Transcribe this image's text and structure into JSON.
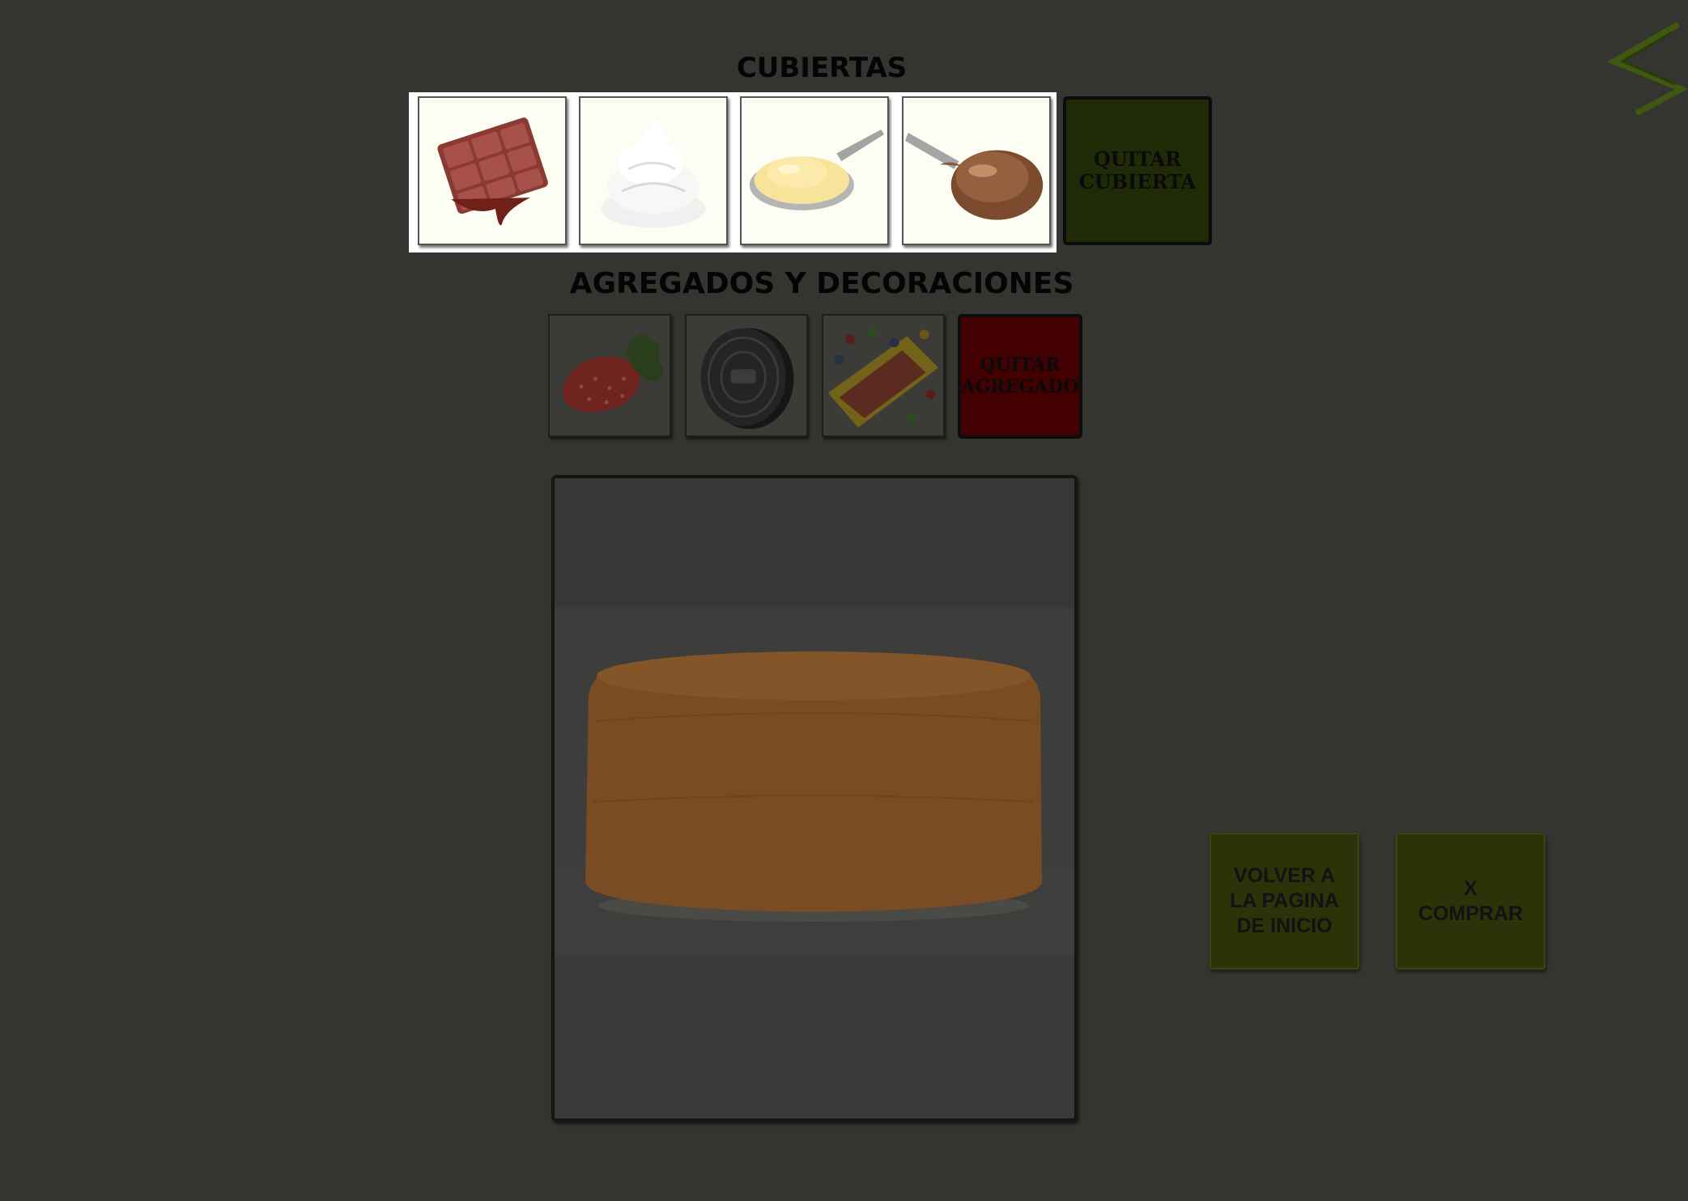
{
  "cubiertas": {
    "title": "CUBIERTAS",
    "options": [
      {
        "name": "chocolate",
        "icon": "chocolate-bar-icon"
      },
      {
        "name": "whipped-cream",
        "icon": "whipped-cream-icon"
      },
      {
        "name": "custard",
        "icon": "custard-spoon-icon"
      },
      {
        "name": "dulce-de-leche",
        "icon": "dulce-de-leche-spoon-icon"
      }
    ],
    "remove_label": "QUITAR CUBIERTA",
    "remove_color": "#212a06"
  },
  "agregados": {
    "title": "AGREGADOS Y DECORACIONES",
    "options": [
      {
        "name": "strawberry",
        "icon": "strawberry-icon"
      },
      {
        "name": "cookie",
        "icon": "sandwich-cookie-icon"
      },
      {
        "name": "candies",
        "icon": "candy-bag-icon"
      }
    ],
    "remove_label": "QUITAR AGREGADO",
    "remove_color": "#430000"
  },
  "preview": {
    "icon": "sponge-cake-image"
  },
  "actions": {
    "back_label": "VOLVER A\nLA PAGINA\nDE INICIO",
    "buy_label": "X\nCOMPRAR",
    "button_color": "#2b3309"
  },
  "brand": {
    "logo_icon": "brand-logo-icon",
    "accent": "#3f5a10"
  }
}
